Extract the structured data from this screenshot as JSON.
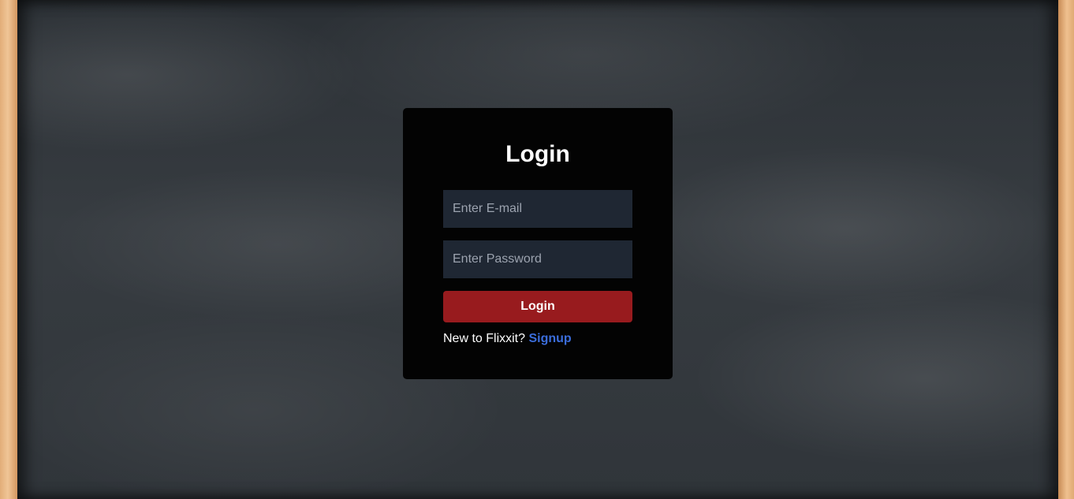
{
  "login_card": {
    "title": "Login",
    "email_placeholder": "Enter E-mail",
    "email_value": "",
    "password_placeholder": "Enter Password",
    "password_value": "",
    "login_button_label": "Login",
    "signup_prompt": "New to Flixxit?",
    "signup_link_label": "Signup"
  },
  "colors": {
    "card_background": "#030303",
    "input_background": "#1f2733",
    "login_button": "#981b1e",
    "signup_link": "#3b6ddb",
    "chalkboard": "#343a3f",
    "frame_wood": "#e2ad78"
  }
}
